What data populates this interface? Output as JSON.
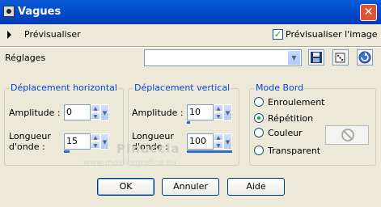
{
  "window": {
    "title": "Vagues"
  },
  "preview": {
    "label": "Prévisualiser",
    "checkbox_label": "Prévisualiser l'image",
    "checked": true
  },
  "settings": {
    "label": "Réglages",
    "value": ""
  },
  "horizontal": {
    "title": "Déplacement horizontal",
    "amplitude_label": "Amplitude :",
    "amplitude_value": "0",
    "wavelength_label_1": "Longueur",
    "wavelength_label_2": "d'onde :",
    "wavelength_value": "15"
  },
  "vertical": {
    "title": "Déplacement vertical",
    "amplitude_label": "Amplitude :",
    "amplitude_value": "10",
    "wavelength_label_1": "Longueur",
    "wavelength_label_2": "d'onde :",
    "wavelength_value": "100"
  },
  "edge_mode": {
    "title": "Mode Bord",
    "options": [
      "Enroulement",
      "Répétition",
      "Couleur",
      "Transparent"
    ],
    "selected": "Répétition"
  },
  "watermark": {
    "text": "Pinuccia",
    "url": "www.moidiregrafica.eu"
  },
  "buttons": {
    "ok": "OK",
    "cancel": "Annuler",
    "help": "Aide"
  }
}
